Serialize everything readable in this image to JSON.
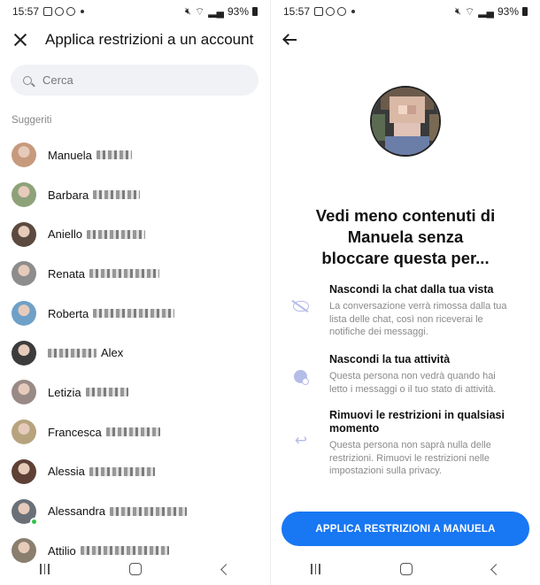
{
  "status_bar": {
    "time": "15:57",
    "battery": "93%"
  },
  "left": {
    "title": "Applica restrizioni a un account",
    "search": {
      "placeholder": "Cerca"
    },
    "section_label": "Suggeriti",
    "contacts": [
      {
        "name": "Manuela",
        "blur_after": true,
        "avatar_color": "#c79a7e",
        "online": false
      },
      {
        "name": "Barbara",
        "blur_after": true,
        "avatar_color": "#8ea27a",
        "online": false
      },
      {
        "name": "Aniello",
        "blur_after": true,
        "avatar_color": "#5c4a40",
        "online": false
      },
      {
        "name": "Renata",
        "blur_after": true,
        "avatar_color": "#8d8d8d",
        "online": false
      },
      {
        "name": "Roberta",
        "blur_after": true,
        "avatar_color": "#6fa0c8",
        "online": false
      },
      {
        "name": "Alex",
        "blur_before": true,
        "avatar_color": "#3c3c3c",
        "online": false
      },
      {
        "name": "Letizia",
        "blur_after": true,
        "avatar_color": "#9a8a86",
        "online": false
      },
      {
        "name": "Francesca",
        "blur_after": true,
        "avatar_color": "#b7a37e",
        "online": false
      },
      {
        "name": "Alessia",
        "blur_after": true,
        "avatar_color": "#5e4036",
        "online": false
      },
      {
        "name": "Alessandra",
        "blur_after": true,
        "avatar_color": "#6b7078",
        "online": true
      },
      {
        "name": "Attilio",
        "blur_after": true,
        "avatar_color": "#8a7e6e",
        "online": false
      }
    ]
  },
  "right": {
    "headline": "Vedi meno contenuti di Manuela senza bloccare questa per...",
    "features": [
      {
        "icon": "eye-off-icon",
        "title": "Nascondi la chat dalla tua vista",
        "description": "La conversazione verrà rimossa dalla tua lista delle chat, così non riceverai le notifiche dei messaggi."
      },
      {
        "icon": "activity-status-icon",
        "title": "Nascondi la tua attività",
        "description": "Questa persona non vedrà quando hai letto i messaggi o il tuo stato di attività."
      },
      {
        "icon": "undo-icon",
        "title": "Rimuovi le restrizioni in qualsiasi momento",
        "description": "Questa persona non saprà nulla delle restrizioni. Rimuovi le restrizioni nelle impostazioni sulla privacy."
      }
    ],
    "cta_label": "APPLICA RESTRIZIONI A MANUELA"
  },
  "colors": {
    "accent": "#1877f2",
    "icon_tint": "#b6bce8",
    "online": "#31c44b"
  }
}
